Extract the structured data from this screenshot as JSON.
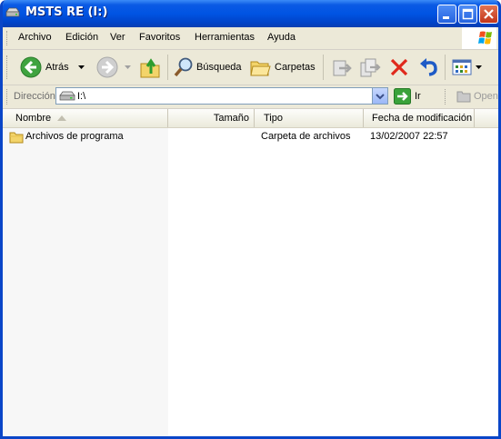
{
  "window": {
    "title": "MSTS RE (I:)",
    "controls": [
      "minimize-icon",
      "maximize-icon",
      "close-icon"
    ]
  },
  "menubar": {
    "items": [
      "Archivo",
      "Edición",
      "Ver",
      "Favoritos",
      "Herramientas",
      "Ayuda"
    ]
  },
  "toolbar": {
    "back_label": "Atrás",
    "search_label": "Búsqueda",
    "folders_label": "Carpetas"
  },
  "address": {
    "label": "Dirección",
    "value": "I:\\",
    "go_label": "Ir",
    "open_label": "Open"
  },
  "columns": {
    "name": "Nombre",
    "size": "Tamaño",
    "type": "Tipo",
    "modified": "Fecha de modificación"
  },
  "files": [
    {
      "name": "Archivos de programa",
      "size": "",
      "type": "Carpeta de archivos",
      "modified": "13/02/2007 22:57"
    }
  ],
  "colors": {
    "titlebar": "#0054e3",
    "frame": "#ece9d8",
    "close_button": "#c3351a"
  }
}
